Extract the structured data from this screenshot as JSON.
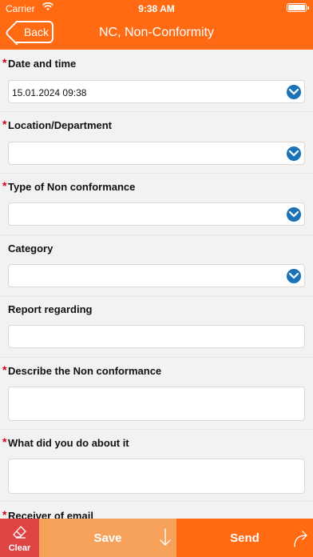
{
  "status_bar": {
    "carrier": "Carrier",
    "time": "9:38 AM"
  },
  "nav": {
    "back_label": "Back",
    "title": "NC, Non-Conformity"
  },
  "form": {
    "required_mark": "*",
    "fields": [
      {
        "label": "Date and time",
        "required": true,
        "type": "select",
        "value": "15.01.2024 09:38"
      },
      {
        "label": "Location/Department",
        "required": true,
        "type": "select",
        "value": ""
      },
      {
        "label": "Type of Non conformance",
        "required": true,
        "type": "select",
        "value": ""
      },
      {
        "label": "Category",
        "required": false,
        "type": "select",
        "value": ""
      },
      {
        "label": "Report regarding",
        "required": false,
        "type": "text",
        "value": ""
      },
      {
        "label": "Describe the Non conformance",
        "required": true,
        "type": "textarea",
        "value": ""
      },
      {
        "label": "What did you do about it",
        "required": true,
        "type": "textarea",
        "value": ""
      },
      {
        "label": "Receiver of email",
        "required": true,
        "type": "text",
        "value": ""
      }
    ]
  },
  "bottom_bar": {
    "clear_label": "Clear",
    "save_label": "Save",
    "send_label": "Send"
  },
  "colors": {
    "accent": "#ff6a13",
    "save": "#f7a25a",
    "clear": "#e04545",
    "dropdown_icon": "#1a73b8",
    "required": "#d0021b"
  }
}
